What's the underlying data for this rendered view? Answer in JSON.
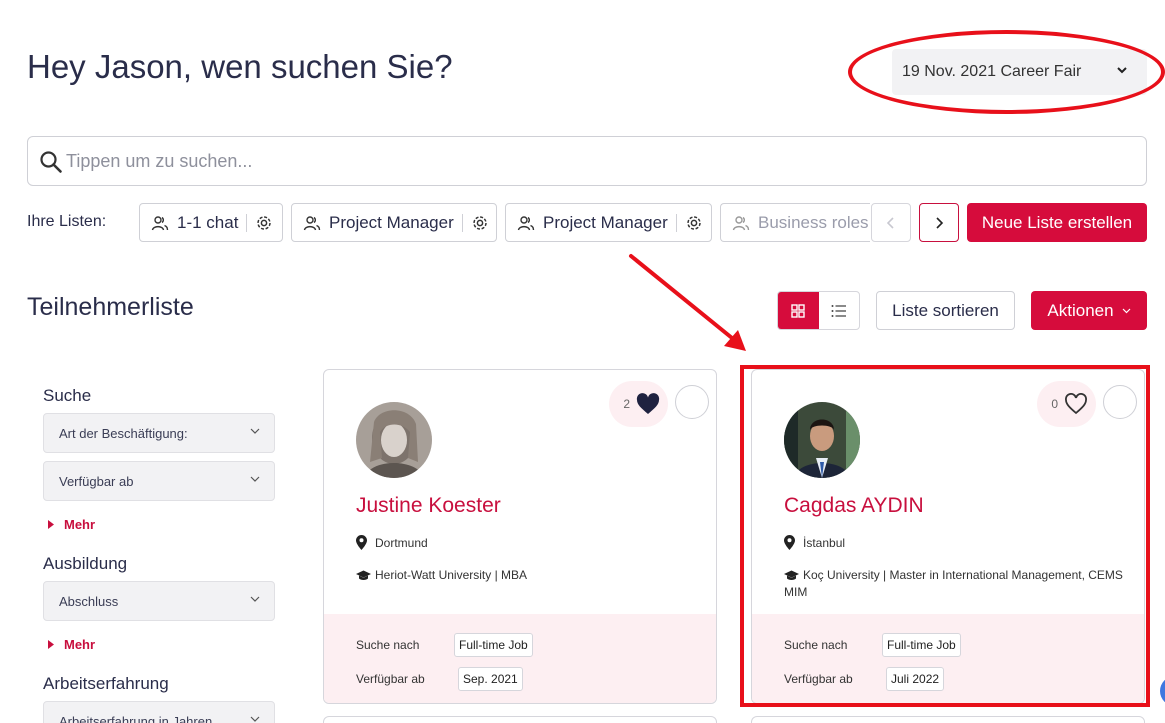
{
  "header": {
    "greeting": "Hey Jason, wen suchen Sie?",
    "event_selected": "19 Nov. 2021 Career Fair"
  },
  "search": {
    "placeholder": "Tippen um zu suchen..."
  },
  "lists": {
    "label": "Ihre Listen:",
    "items": [
      {
        "label": "1-1 chat"
      },
      {
        "label": "Project Manager"
      },
      {
        "label": "Project Manager"
      },
      {
        "label": "Business roles"
      }
    ],
    "create_button": "Neue Liste erstellen"
  },
  "participants": {
    "title": "Teilnehmerliste",
    "sort_button": "Liste sortieren",
    "actions_button": "Aktionen"
  },
  "filters": {
    "search_heading": "Suche",
    "employment_type": "Art der Beschäftigung:",
    "available_from": "Verfügbar ab",
    "more_1": "Mehr",
    "education_heading": "Ausbildung",
    "degree": "Abschluss",
    "more_2": "Mehr",
    "experience_heading": "Arbeitserfahrung",
    "experience_years": "Arbeitserfahrung in Jahren"
  },
  "cards": [
    {
      "name": "Justine Koester",
      "location": "Dortmund",
      "education": "Heriot-Watt University | MBA",
      "likes": "2",
      "seeking_label": "Suche nach",
      "seeking_value": "Full-time Job",
      "available_label": "Verfügbar ab",
      "available_value": "Sep. 2021"
    },
    {
      "name": "Cagdas AYDIN",
      "location": "İstanbul",
      "education": "Koç University | Master in International Management, CEMS MIM",
      "likes": "0",
      "seeking_label": "Suche nach",
      "seeking_value": "Full-time Job",
      "available_label": "Verfügbar ab",
      "available_value": "Juli 2022"
    }
  ],
  "colors": {
    "accent": "#d60c3c",
    "annotation": "#e8101a",
    "text": "#2a2d4a"
  }
}
